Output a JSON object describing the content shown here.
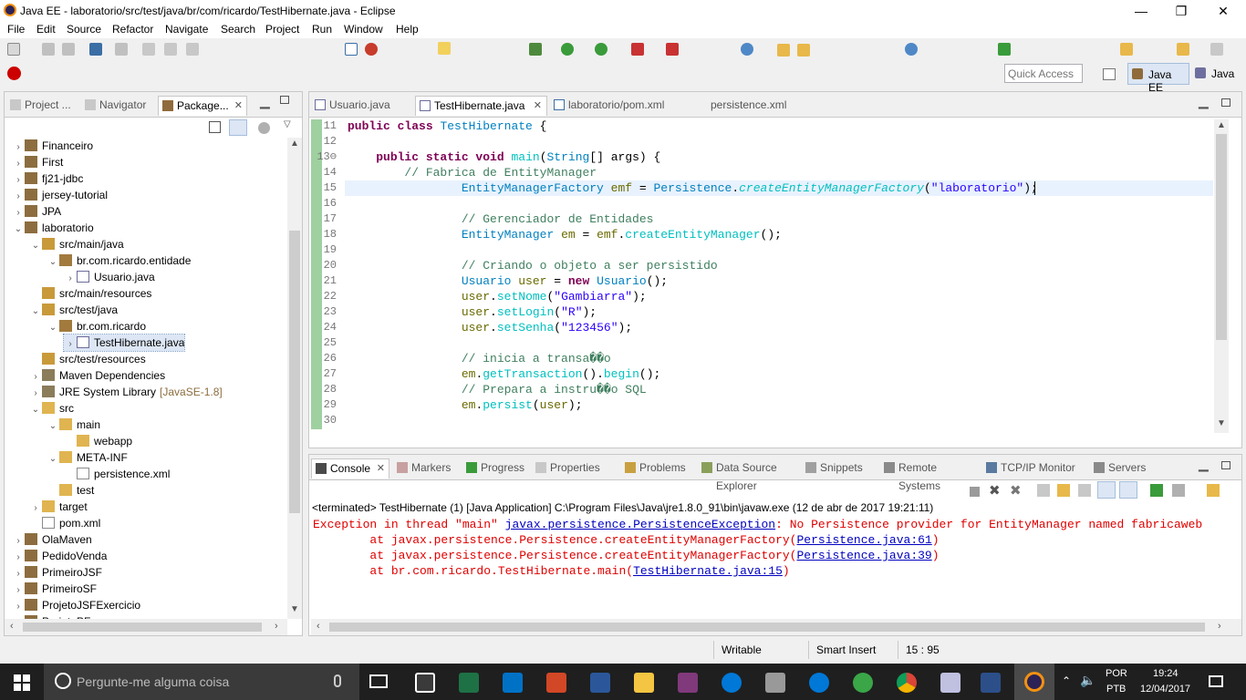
{
  "window": {
    "title": "Java EE - laboratorio/src/test/java/br/com/ricardo/TestHibernate.java - Eclipse",
    "minimize": "—",
    "maximize": "❐",
    "close": "✕"
  },
  "menu": [
    "File",
    "Edit",
    "Source",
    "Refactor",
    "Navigate",
    "Search",
    "Project",
    "Run",
    "Window",
    "Help"
  ],
  "quick_access": {
    "placeholder": "Quick Access"
  },
  "perspectives": [
    {
      "label": "Java EE"
    },
    {
      "label": "Java"
    }
  ],
  "left_panel": {
    "tabs": [
      {
        "label": "Project ..."
      },
      {
        "label": "Navigator"
      },
      {
        "label": "Package..."
      }
    ],
    "tree": [
      {
        "label": "Financeiro",
        "indent": 0,
        "arrow": "›",
        "icon": "project"
      },
      {
        "label": "First",
        "indent": 0,
        "arrow": "›",
        "icon": "project"
      },
      {
        "label": "fj21-jdbc",
        "indent": 0,
        "arrow": "›",
        "icon": "project"
      },
      {
        "label": "jersey-tutorial",
        "indent": 0,
        "arrow": "›",
        "icon": "project"
      },
      {
        "label": "JPA",
        "indent": 0,
        "arrow": "›",
        "icon": "project"
      },
      {
        "label": "laboratorio",
        "indent": 0,
        "arrow": "⌄",
        "icon": "project-maven"
      },
      {
        "label": "src/main/java",
        "indent": 1,
        "arrow": "⌄",
        "icon": "src-folder"
      },
      {
        "label": "br.com.ricardo.entidade",
        "indent": 2,
        "arrow": "⌄",
        "icon": "package"
      },
      {
        "label": "Usuario.java",
        "indent": 3,
        "arrow": "›",
        "icon": "java-file"
      },
      {
        "label": "src/main/resources",
        "indent": 1,
        "arrow": "",
        "icon": "src-folder"
      },
      {
        "label": "src/test/java",
        "indent": 1,
        "arrow": "⌄",
        "icon": "src-folder"
      },
      {
        "label": "br.com.ricardo",
        "indent": 2,
        "arrow": "⌄",
        "icon": "package"
      },
      {
        "label": "TestHibernate.java",
        "indent": 3,
        "arrow": "›",
        "icon": "java-file",
        "selected": true
      },
      {
        "label": "src/test/resources",
        "indent": 1,
        "arrow": "",
        "icon": "src-folder"
      },
      {
        "label": "Maven Dependencies",
        "indent": 1,
        "arrow": "›",
        "icon": "library"
      },
      {
        "label": "JRE System Library",
        "extra": "[JavaSE-1.8]",
        "indent": 1,
        "arrow": "›",
        "icon": "library"
      },
      {
        "label": "src",
        "indent": 1,
        "arrow": "⌄",
        "icon": "folder"
      },
      {
        "label": "main",
        "indent": 2,
        "arrow": "⌄",
        "icon": "folder"
      },
      {
        "label": "webapp",
        "indent": 3,
        "arrow": "",
        "icon": "folder"
      },
      {
        "label": "META-INF",
        "indent": 2,
        "arrow": "⌄",
        "icon": "folder"
      },
      {
        "label": "persistence.xml",
        "indent": 3,
        "arrow": "",
        "icon": "xml-file"
      },
      {
        "label": "test",
        "indent": 2,
        "arrow": "",
        "icon": "folder"
      },
      {
        "label": "target",
        "indent": 1,
        "arrow": "›",
        "icon": "folder"
      },
      {
        "label": "pom.xml",
        "indent": 1,
        "arrow": "",
        "icon": "xml-file"
      },
      {
        "label": "OlaMaven",
        "indent": 0,
        "arrow": "›",
        "icon": "project-maven"
      },
      {
        "label": "PedidoVenda",
        "indent": 0,
        "arrow": "›",
        "icon": "project-maven"
      },
      {
        "label": "PrimeiroJSF",
        "indent": 0,
        "arrow": "›",
        "icon": "project"
      },
      {
        "label": "PrimeiroSF",
        "indent": 0,
        "arrow": "›",
        "icon": "project"
      },
      {
        "label": "ProjetoJSFExercicio",
        "indent": 0,
        "arrow": "›",
        "icon": "project"
      },
      {
        "label": "ProjetoPF",
        "indent": 0,
        "arrow": "›",
        "icon": "project"
      }
    ]
  },
  "editor": {
    "tabs": [
      {
        "label": "Usuario.java"
      },
      {
        "label": "TestHibernate.java",
        "active": true
      },
      {
        "label": "laboratorio/pom.xml"
      },
      {
        "label": "persistence.xml"
      }
    ],
    "lines": [
      {
        "n": "11",
        "html": "<span class=\"kw\">public class</span> <span class=\"ty\">TestHibernate</span> {"
      },
      {
        "n": "12",
        "html": ""
      },
      {
        "n": "13⊖",
        "html": "    <span class=\"kw\">public static void</span> <span class=\"mt\">main</span>(<span class=\"ty\">String</span>[] args) {"
      },
      {
        "n": "14",
        "html": "        <span class=\"cm\">// Fabrica de EntityManager</span>"
      },
      {
        "n": "15",
        "html": "                <span class=\"ty\">EntityManagerFactory</span> <span class=\"vr\">emf</span> = <span class=\"ty\">Persistence</span>.<span class=\"mt\"><i>createEntityManagerFactory</i></span>(<span class=\"st\">\"laboratorio\"</span>);",
        "current": true
      },
      {
        "n": "16",
        "html": ""
      },
      {
        "n": "17",
        "html": "                <span class=\"cm\">// Gerenciador de Entidades</span>"
      },
      {
        "n": "18",
        "html": "                <span class=\"ty\">EntityManager</span> <span class=\"vr\">em</span> = <span class=\"vr\">emf</span>.<span class=\"mt\">createEntityManager</span>();"
      },
      {
        "n": "19",
        "html": ""
      },
      {
        "n": "20",
        "html": "                <span class=\"cm\">// Criando o objeto a ser persistido</span>"
      },
      {
        "n": "21",
        "html": "                <span class=\"ty\">Usuario</span> <span class=\"vr\">user</span> = <span class=\"kw\">new</span> <span class=\"ty\">Usuario</span>();"
      },
      {
        "n": "22",
        "html": "                <span class=\"vr\">user</span>.<span class=\"mt\">setNome</span>(<span class=\"st\">\"Gambiarra\"</span>);"
      },
      {
        "n": "23",
        "html": "                <span class=\"vr\">user</span>.<span class=\"mt\">setLogin</span>(<span class=\"st\">\"R\"</span>);"
      },
      {
        "n": "24",
        "html": "                <span class=\"vr\">user</span>.<span class=\"mt\">setSenha</span>(<span class=\"st\">\"123456\"</span>);"
      },
      {
        "n": "25",
        "html": ""
      },
      {
        "n": "26",
        "html": "                <span class=\"cm\">// inicia a transa��o</span>"
      },
      {
        "n": "27",
        "html": "                <span class=\"vr\">em</span>.<span class=\"mt\">getTransaction</span>().<span class=\"mt\">begin</span>();"
      },
      {
        "n": "28",
        "html": "                <span class=\"cm\">// Prepara a instru��o SQL</span>"
      },
      {
        "n": "29",
        "html": "                <span class=\"vr\">em</span>.<span class=\"mt\">persist</span>(<span class=\"vr\">user</span>);"
      },
      {
        "n": "30",
        "html": ""
      }
    ]
  },
  "bottom_panel": {
    "tabs": [
      {
        "label": "Console",
        "active": true
      },
      {
        "label": "Markers"
      },
      {
        "label": "Progress"
      },
      {
        "label": "Properties"
      },
      {
        "label": "Problems"
      },
      {
        "label": "Data Source Explorer"
      },
      {
        "label": "Snippets"
      },
      {
        "label": "Remote Systems"
      },
      {
        "label": "TCP/IP Monitor"
      },
      {
        "label": "Servers"
      }
    ],
    "header": "<terminated> TestHibernate (1) [Java Application] C:\\Program Files\\Java\\jre1.8.0_91\\bin\\javaw.exe (12 de abr de 2017 19:21:11)",
    "output": [
      {
        "pre": "Exception in thread \"main\" ",
        "link": "javax.persistence.PersistenceException",
        "post": ": No Persistence provider for EntityManager named fabricaweb"
      },
      {
        "pre": "        at javax.persistence.Persistence.createEntityManagerFactory(",
        "link": "Persistence.java:61",
        "post": ")"
      },
      {
        "pre": "        at javax.persistence.Persistence.createEntityManagerFactory(",
        "link": "Persistence.java:39",
        "post": ")"
      },
      {
        "pre": "        at br.com.ricardo.TestHibernate.main(",
        "link": "TestHibernate.java:15",
        "post": ")"
      }
    ]
  },
  "status": {
    "writable": "Writable",
    "insert_mode": "Smart Insert",
    "position": "15 : 95"
  },
  "taskbar": {
    "search_placeholder": "Pergunte-me alguma coisa",
    "lang1": "POR",
    "lang2": "PTB",
    "time": "19:24",
    "date": "12/04/2017"
  },
  "colors": {
    "accent": "#0078d7",
    "error": "#e00000",
    "link": "#0000c0",
    "keyword": "#7f0055",
    "comment": "#3f7f5f",
    "string": "#2a00ff"
  }
}
